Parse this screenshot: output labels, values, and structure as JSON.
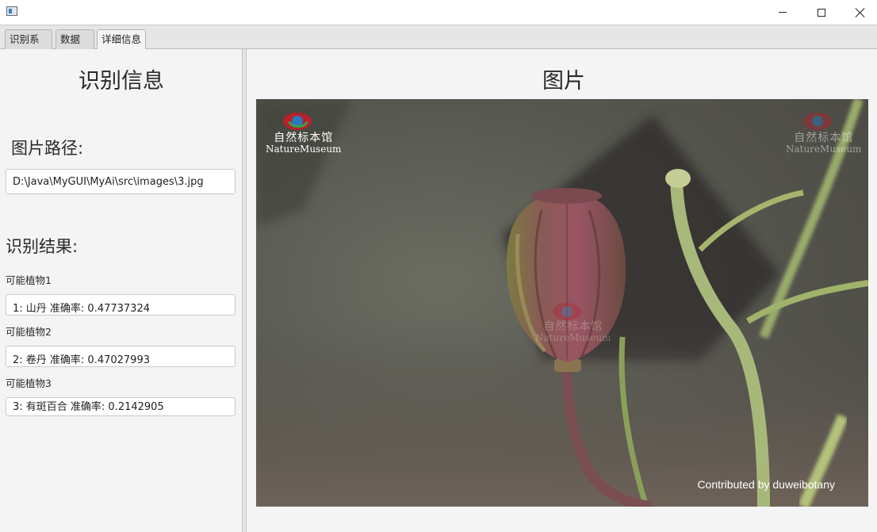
{
  "window": {
    "icon": "app-window-icon",
    "controls": [
      "minimize-icon",
      "maximize-icon",
      "close-icon"
    ]
  },
  "tabs": [
    {
      "label": "识别系统",
      "active": false
    },
    {
      "label": "数据库",
      "active": false
    },
    {
      "label": "详细信息",
      "active": true
    }
  ],
  "left": {
    "title": "识别信息",
    "path_label": "图片路径:",
    "path_value": "D:\\Java\\MyGUI\\MyAi\\src\\images\\3.jpg",
    "result_label": "识别结果:",
    "results": [
      {
        "label": "可能植物1",
        "value": "1: 山丹 准确率:   0.47737324"
      },
      {
        "label": "可能植物2",
        "value": "2: 卷丹 准确率:   0.47027993"
      },
      {
        "label": "可能植物3",
        "value": "3: 有斑百合 准确率:   0.2142905"
      }
    ]
  },
  "right": {
    "title": "图片",
    "image": {
      "watermark_cn": "自然标本馆",
      "watermark_en": "NatureMuseum",
      "credit": "Contributed by duweibotany"
    }
  }
}
